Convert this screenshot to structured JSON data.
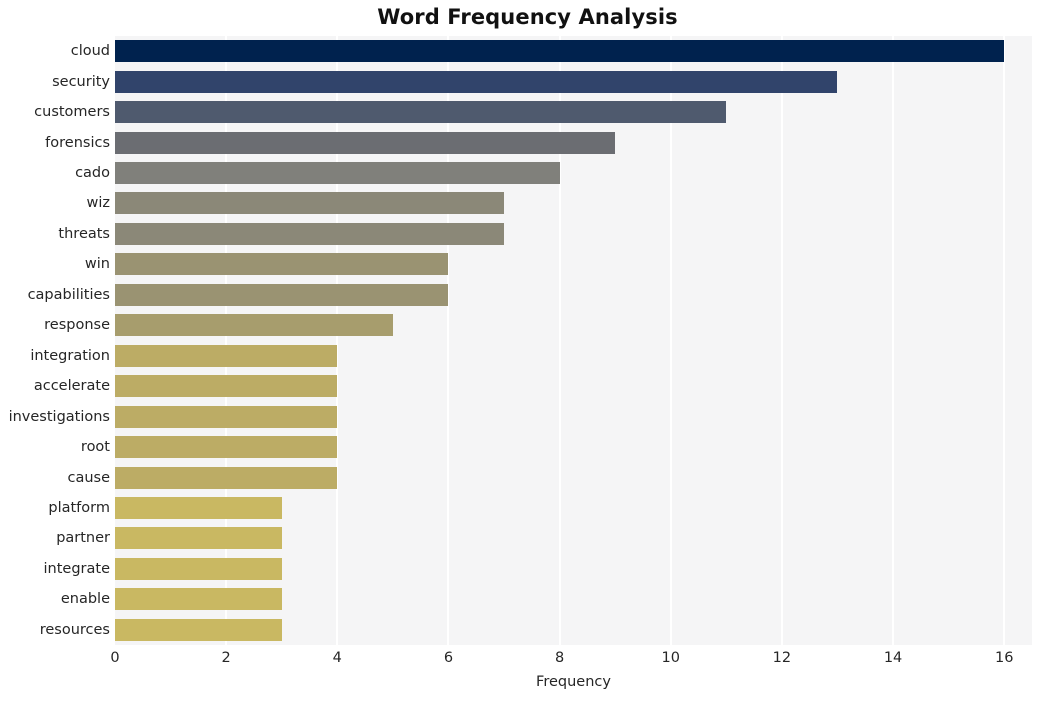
{
  "chart_data": {
    "type": "bar",
    "orientation": "horizontal",
    "title": "Word Frequency Analysis",
    "xlabel": "Frequency",
    "ylabel": "",
    "categories": [
      "cloud",
      "security",
      "customers",
      "forensics",
      "cado",
      "wiz",
      "threats",
      "win",
      "capabilities",
      "response",
      "integration",
      "accelerate",
      "investigations",
      "root",
      "cause",
      "platform",
      "partner",
      "integrate",
      "enable",
      "resources"
    ],
    "values": [
      16,
      13,
      11,
      9,
      8,
      7,
      7,
      6,
      6,
      5,
      4,
      4,
      4,
      4,
      4,
      3,
      3,
      3,
      3,
      3
    ],
    "bar_colors": [
      "#00224e",
      "#31446b",
      "#4f5a6e",
      "#6b6d72",
      "#80807b",
      "#8b8878",
      "#8b8878",
      "#9a9372",
      "#9a9372",
      "#a79d6d",
      "#bcac65",
      "#bcac65",
      "#bcac65",
      "#bcac65",
      "#bcac65",
      "#c9b862",
      "#c9b862",
      "#c9b862",
      "#c9b862",
      "#c9b862"
    ],
    "xlim": [
      0,
      16.5
    ],
    "xticks": [
      0,
      2,
      4,
      6,
      8,
      10,
      12,
      14,
      16
    ],
    "xticklabels": [
      "0",
      "2",
      "4",
      "6",
      "8",
      "10",
      "12",
      "14",
      "16"
    ],
    "grid": "vertical-white",
    "legend": "none",
    "plot_background": "#f5f5f6",
    "figure_background": "#ffffff"
  }
}
